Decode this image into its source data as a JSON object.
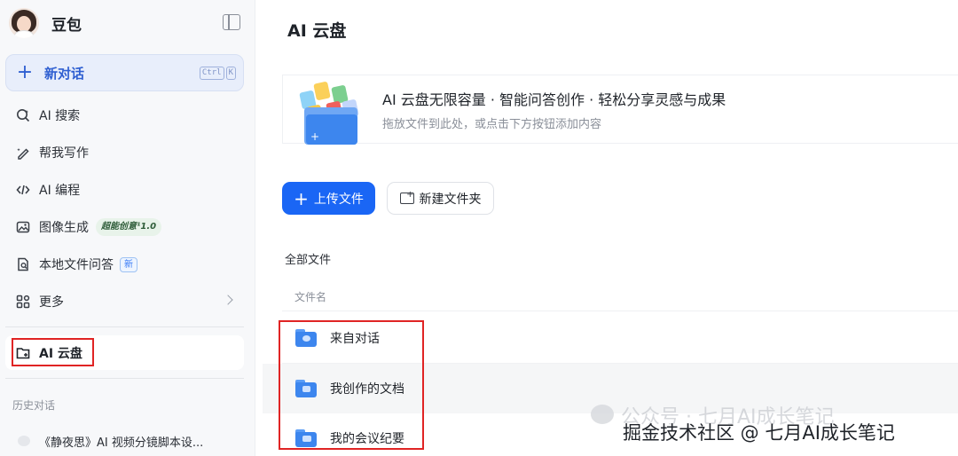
{
  "sidebar": {
    "brand_name": "豆包",
    "new_chat": {
      "label": "新对话",
      "shortcut": [
        "Ctrl",
        "K"
      ]
    },
    "items": [
      {
        "label": "AI 搜索",
        "icon": "search-spark-icon"
      },
      {
        "label": "帮我写作",
        "icon": "pen-icon"
      },
      {
        "label": "AI 编程",
        "icon": "code-icon"
      },
      {
        "label": "图像生成",
        "icon": "image-icon",
        "badge": "超能创意¹1.0"
      },
      {
        "label": "本地文件问答",
        "icon": "file-search-icon",
        "badge": "新"
      },
      {
        "label": "更多",
        "icon": "grid-icon"
      }
    ],
    "cloud_item": {
      "label": "AI 云盘",
      "icon": "cloud-folder-icon"
    },
    "history_title": "历史对话",
    "history_items": [
      {
        "label": "《静夜思》AI 视频分镜脚本设..."
      }
    ]
  },
  "main": {
    "title": "AI 云盘",
    "upload_zone": {
      "headline": "AI 云盘无限容量 · 智能问答创作 · 轻松分享灵感与成果",
      "subtext": "拖放文件到此处，或点击下方按钮添加内容"
    },
    "buttons": {
      "upload": "上传文件",
      "new_folder": "新建文件夹"
    },
    "section_label": "全部文件",
    "column_header": "文件名",
    "files": [
      {
        "name": "来自对话",
        "icon": "chat-folder-icon"
      },
      {
        "name": "我创作的文档",
        "icon": "document-folder-icon"
      },
      {
        "name": "我的会议纪要",
        "icon": "video-folder-icon"
      }
    ]
  },
  "overlay": {
    "watermark": "公众号 · 七月AI成长笔记",
    "credit": "掘金技术社区 @ 七月AI成长笔记"
  },
  "colors": {
    "accent": "#1a66f5",
    "highlight_box": "#e02424",
    "sidebar_bg": "#f7f8fa"
  }
}
